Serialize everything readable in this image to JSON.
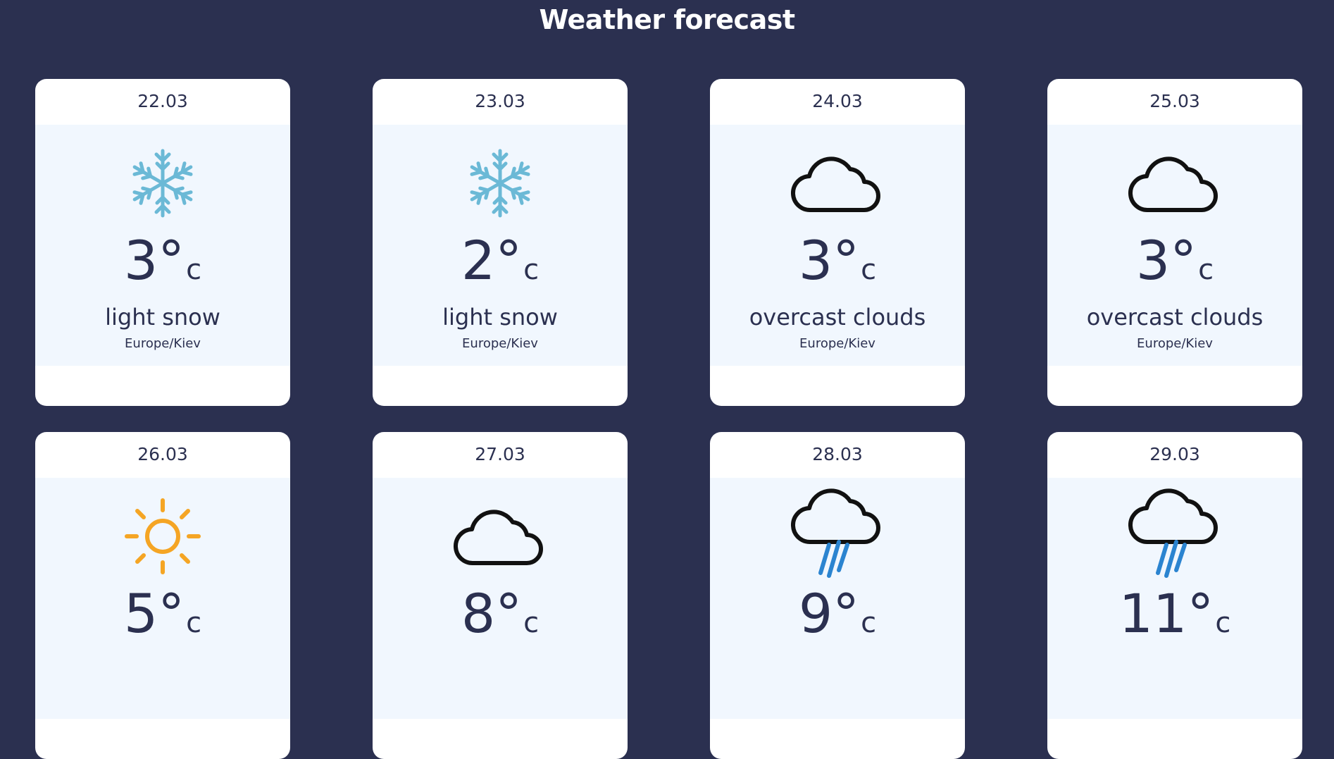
{
  "header": {
    "title": "Weather forecast"
  },
  "colors": {
    "background": "#2b3050",
    "card": "#ffffff",
    "card_body": "#f1f7fe",
    "text": "#2b3050",
    "snow_icon": "#6bb9d6",
    "sun_icon": "#f5a524",
    "cloud_icon": "#111111",
    "rain_icon": "#2b84d0"
  },
  "cards": [
    {
      "date": "22.03",
      "icon": "snowflake-icon",
      "temp": "3°",
      "unit": "c",
      "description": "light snow",
      "timezone": "Europe/Kiev"
    },
    {
      "date": "23.03",
      "icon": "snowflake-icon",
      "temp": "2°",
      "unit": "c",
      "description": "light snow",
      "timezone": "Europe/Kiev"
    },
    {
      "date": "24.03",
      "icon": "cloud-icon",
      "temp": "3°",
      "unit": "c",
      "description": "overcast clouds",
      "timezone": "Europe/Kiev"
    },
    {
      "date": "25.03",
      "icon": "cloud-icon",
      "temp": "3°",
      "unit": "c",
      "description": "overcast clouds",
      "timezone": "Europe/Kiev"
    },
    {
      "date": "26.03",
      "icon": "sun-icon",
      "temp": "5°",
      "unit": "c",
      "description": "",
      "timezone": ""
    },
    {
      "date": "27.03",
      "icon": "cloud-icon",
      "temp": "8°",
      "unit": "c",
      "description": "",
      "timezone": ""
    },
    {
      "date": "28.03",
      "icon": "rain-cloud-icon",
      "temp": "9°",
      "unit": "c",
      "description": "",
      "timezone": ""
    },
    {
      "date": "29.03",
      "icon": "rain-cloud-icon",
      "temp": "11°",
      "unit": "c",
      "description": "",
      "timezone": ""
    }
  ]
}
